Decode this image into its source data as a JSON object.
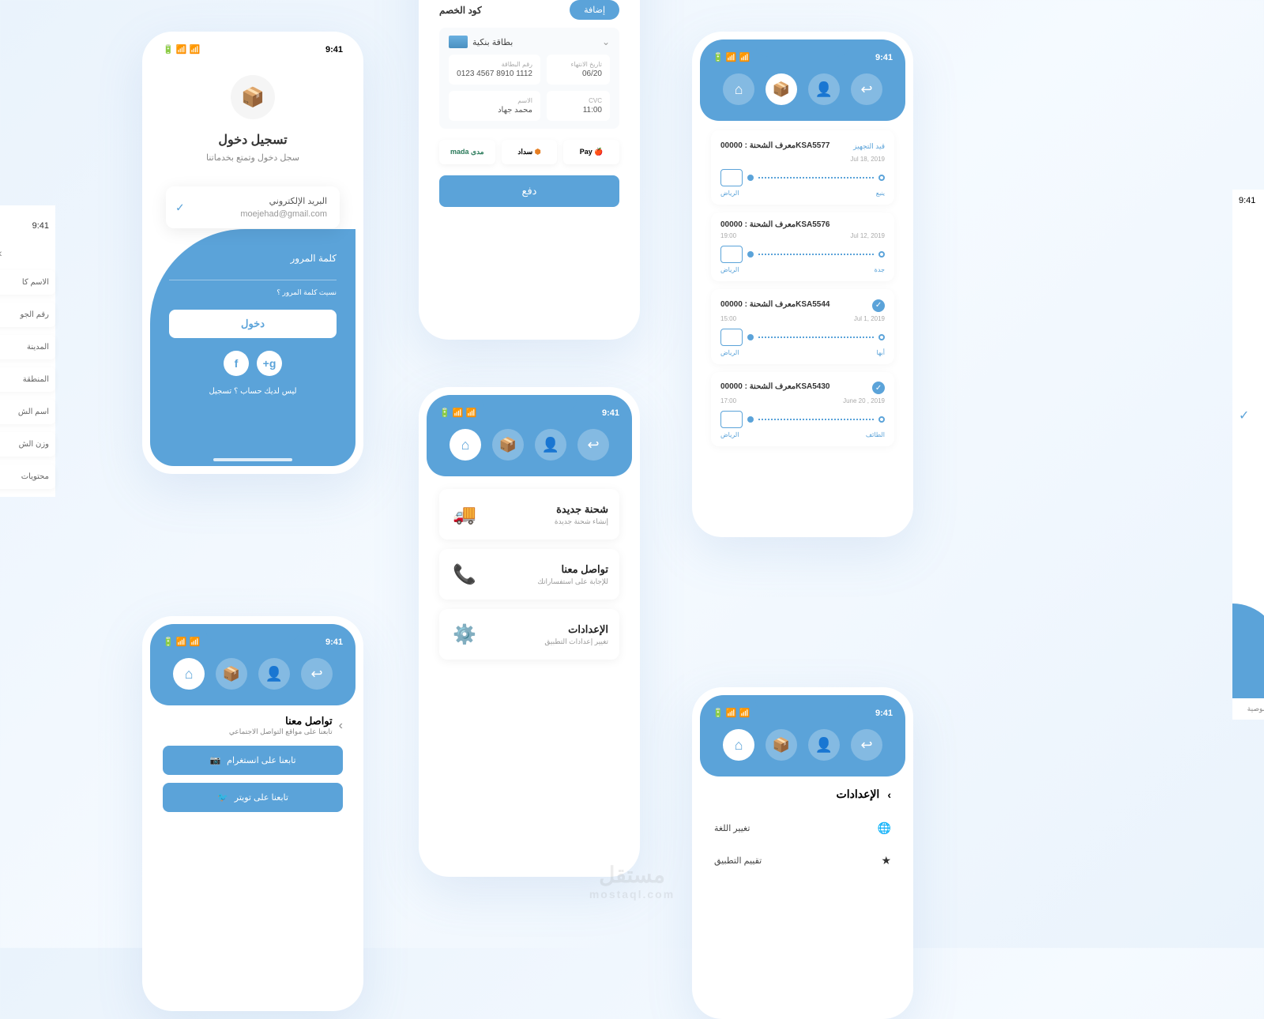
{
  "time": "9:41",
  "login": {
    "title": "تسجيل دخول",
    "subtitle": "سجل دخول وتمتع بخدماتنا",
    "email_label": "البريد الإلكتروني",
    "email_value": "moejehad@gmail.com",
    "password_label": "كلمة المرور",
    "forgot": "نسيت كلمة المرور ؟",
    "login_btn": "دخول",
    "no_account": "ليس لديك حساب ؟  تسجيل",
    "logo": "📦"
  },
  "payment": {
    "discount_label": "كود الخصم",
    "add_btn": "إضافة",
    "card_title": "بطاقة بنكية",
    "card_number_label": "رقم البطاقة",
    "card_number": "0123 4567 8910 1112",
    "expiry_label": "تاريخ الانتهاء",
    "expiry": "06/20",
    "name_label": "الاسم",
    "name": "محمد جهاد",
    "cvc_label": "CVC",
    "cvc": "11:00",
    "method1": "🍎 Pay",
    "method2": "سداد",
    "method3": "مدى mada",
    "pay_btn": "دفع"
  },
  "shipments": [
    {
      "id": "00000KSA5577",
      "label": "معرف الشحنة :",
      "status": "قيد التجهيز",
      "date": "Jul 18, 2019",
      "from": "الرياض",
      "to": "ينبع"
    },
    {
      "id": "00000KSA5576",
      "label": "معرف الشحنة :",
      "status": "",
      "date": "Jul 12, 2019",
      "time": "19:00",
      "from": "الرياض",
      "to": "جدة"
    },
    {
      "id": "00000KSA5544",
      "label": "معرف الشحنة :",
      "status": "done",
      "date": "Jul 1, 2019",
      "time": "15:00",
      "from": "الرياض",
      "to": "أبها"
    },
    {
      "id": "00000KSA5430",
      "label": "معرف الشحنة :",
      "status": "done",
      "date": "June 20 , 2019",
      "time": "17:00",
      "from": "الرياض",
      "to": "الطائف"
    }
  ],
  "home_menu": [
    {
      "title": "شحنة جديدة",
      "sub": "إنشاء شحنة جديدة",
      "icon": "🚚"
    },
    {
      "title": "تواصل معنا",
      "sub": "للإجابة على استفساراتك",
      "icon": "📞"
    },
    {
      "title": "الإعدادات",
      "sub": "تغيير إعدادات التطبيق",
      "icon": "⚙️"
    }
  ],
  "contact": {
    "title": "تواصل معنا",
    "sub": "تابعنا على مواقع التواصل الاجتماعي",
    "instagram": "تابعنا على انستغرام",
    "twitter": "تابعنا على تويتر"
  },
  "settings": {
    "title": "الإعدادات",
    "lang": "تغيير اللغة",
    "rate": "تقييم التطبيق"
  },
  "side_fields": [
    "الاسم كا",
    "رقم الجو",
    "المدينة",
    "المنطقة",
    "اسم الش",
    "وزن الش",
    "محتويات"
  ],
  "side_right": "خصوصية",
  "watermark": "مستقل",
  "watermark_sub": "mostaql.com"
}
